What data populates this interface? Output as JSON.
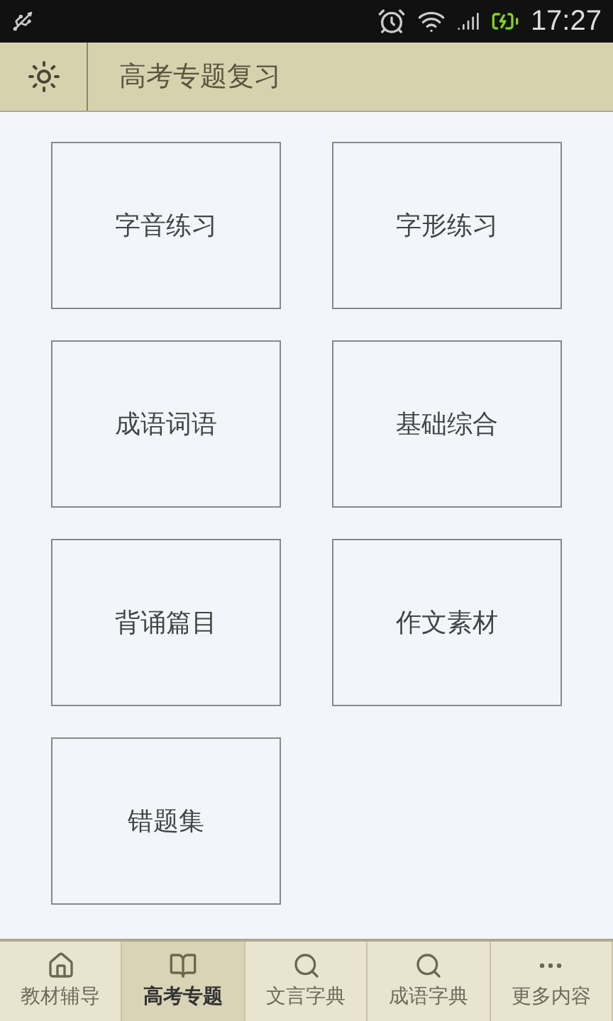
{
  "status_bar": {
    "time": "17:27"
  },
  "header": {
    "title": "高考专题复习"
  },
  "tiles": [
    {
      "label": "字音练习"
    },
    {
      "label": "字形练习"
    },
    {
      "label": "成语词语"
    },
    {
      "label": "基础综合"
    },
    {
      "label": "背诵篇目"
    },
    {
      "label": "作文素材"
    },
    {
      "label": "错题集"
    }
  ],
  "bottom_nav": [
    {
      "label": "教材辅导",
      "kind": "home",
      "selected": false
    },
    {
      "label": "高考专题",
      "kind": "book",
      "selected": true
    },
    {
      "label": "文言字典",
      "kind": "search",
      "selected": false
    },
    {
      "label": "成语字典",
      "kind": "search",
      "selected": false
    },
    {
      "label": "更多内容",
      "kind": "more",
      "selected": false
    }
  ]
}
